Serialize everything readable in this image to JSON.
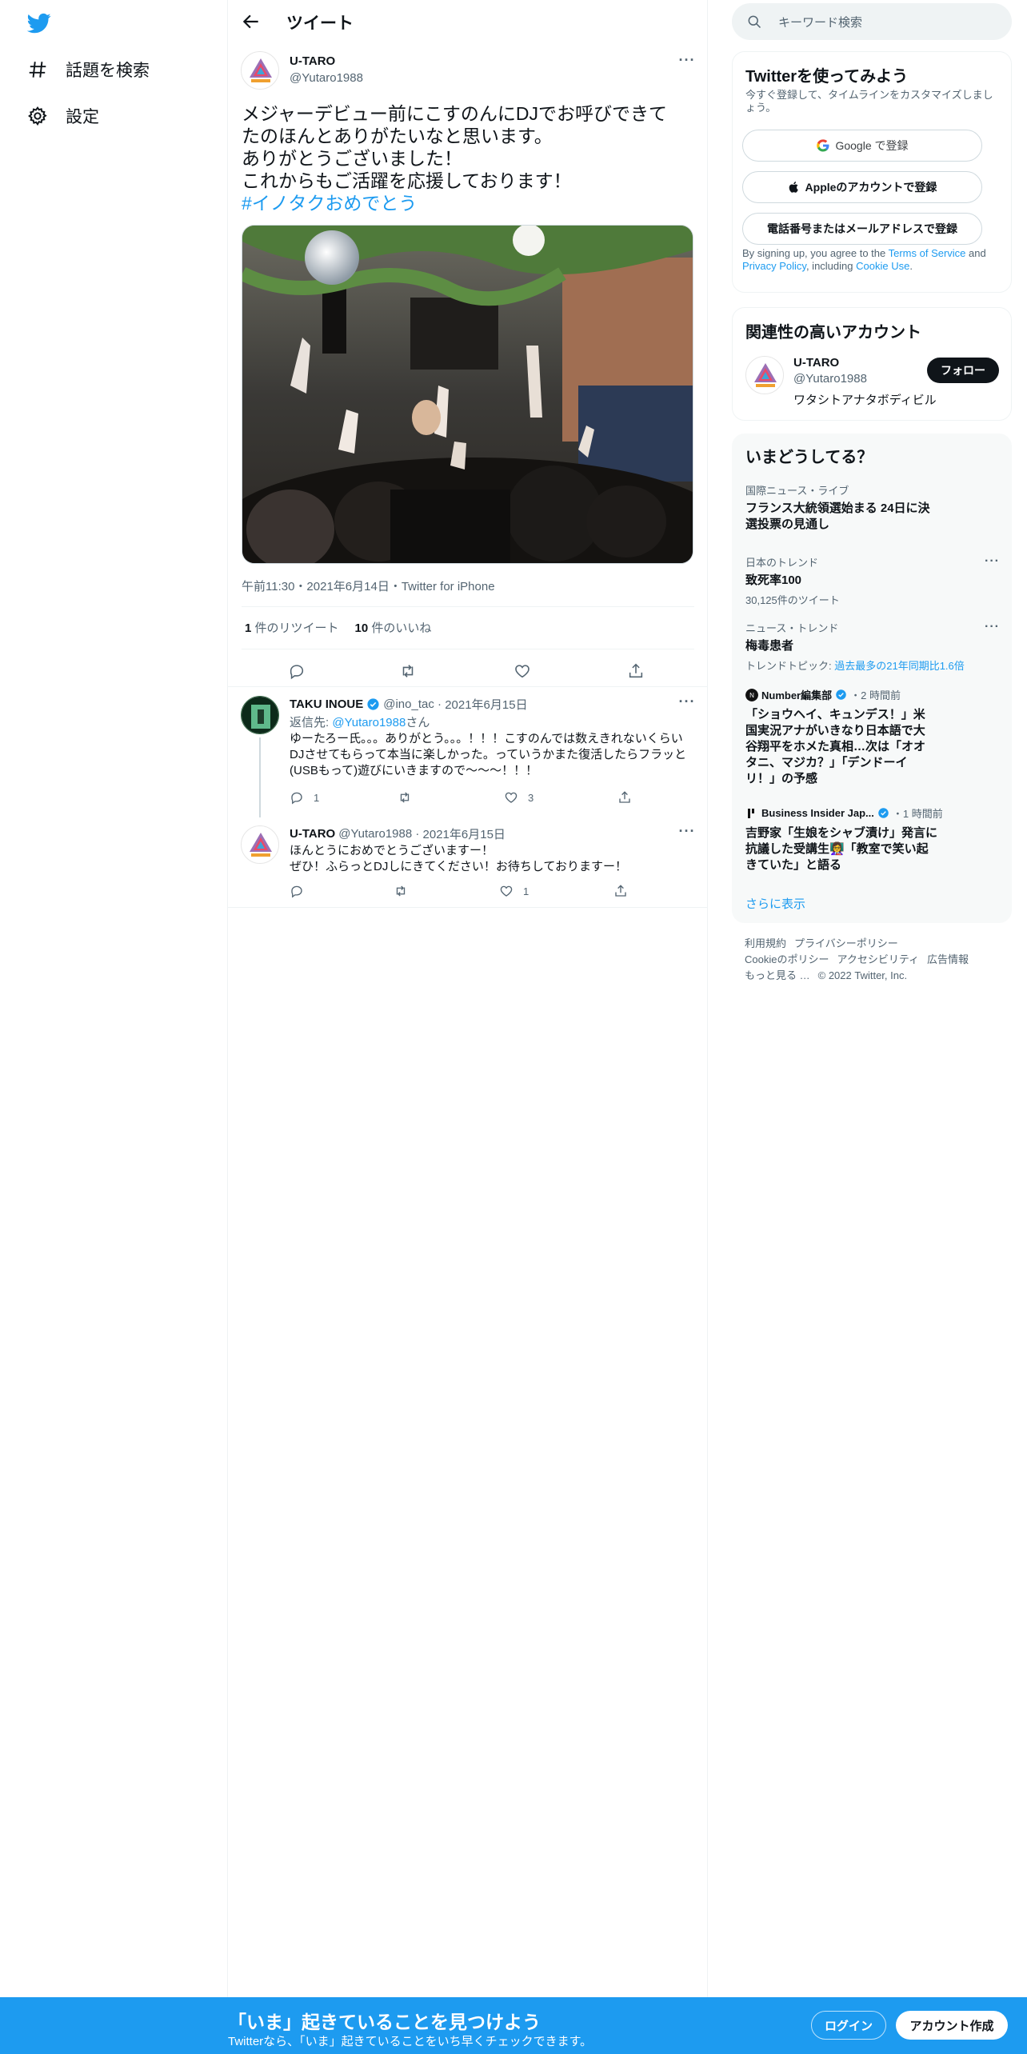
{
  "nav": {
    "logo": "twitter-bird-icon",
    "items": [
      {
        "label": "話題を検索",
        "icon": "hashtag-icon"
      },
      {
        "label": "設定",
        "icon": "gear-icon"
      }
    ]
  },
  "header": {
    "title": "ツイート"
  },
  "tweet": {
    "name": "U-TARO",
    "handle": "@Yutaro1988",
    "text": "メジャーデビュー前にこすのんにDJでお呼びできて\nたのほんとありがたいなと思います。\nありがとうございました！\nこれからもご活躍を応援しております！",
    "hashtag": "#イノタクおめでとう",
    "meta": "午前11:30・2021年6月14日・Twitter for iPhone",
    "retweets_count": "1",
    "retweets_label": "件のリツイート",
    "likes_count": "10",
    "likes_label": "件のいいね"
  },
  "replies": [
    {
      "name": "TAKU INOUE",
      "handle": "@ino_tac",
      "time": "2021年6月15日",
      "reply_to_prefix": "返信先: ",
      "reply_to_handle": "@Yutaro1988",
      "reply_to_suffix": "さん",
      "text": "ゆーたろー氏。。。ありがとう。。。！！！こすのんでは数えきれないくらいDJさせてもらって本当に楽しかった。っていうかまた復活したらフラッと(USBもって)遊びにいきますので〜〜〜！！！",
      "reply_count": "1",
      "retweet_count": "",
      "like_count": "3"
    },
    {
      "name": "U-TARO",
      "handle": "@Yutaro1988",
      "time": "2021年6月15日",
      "text": "ほんとうにおめでとうございますー！\nぜひ！ふらっとDJしにきてください！お待ちしておりますー！",
      "reply_count": "",
      "retweet_count": "",
      "like_count": "1"
    }
  ],
  "search": {
    "placeholder": "キーワード検索"
  },
  "signup": {
    "title": "Twitterを使ってみよう",
    "subtitle": "今すぐ登録して、タイムラインをカスタマイズしましょう。",
    "google": "Google で登録",
    "apple": "Appleのアカウントで登録",
    "phone": "電話番号またはメールアドレスで登録",
    "legal_prefix": "By signing up, you agree to the ",
    "terms": "Terms of Service",
    "legal_and": " and ",
    "privacy": "Privacy Policy",
    "legal_including": ", including ",
    "cookie": "Cookie Use",
    "legal_end": "."
  },
  "related": {
    "title": "関連性の高いアカウント",
    "name": "U-TARO",
    "handle": "@Yutaro1988",
    "bio": "ワタシトアナタボディビル",
    "follow": "フォロー"
  },
  "trends": {
    "title": "いまどうしてる？",
    "items": [
      {
        "context": "国際ニュース・ライブ",
        "name": "フランス大統領選始まる 24日に決選投票の見通し"
      },
      {
        "context": "日本のトレンド",
        "name": "致死率100",
        "count": "30,125件のツイート"
      },
      {
        "context": "ニュース・トレンド",
        "name": "梅毒患者",
        "topic_prefix": "トレンドトピック: ",
        "topic": "過去最多の21年同期比1.6倍"
      },
      {
        "source": "Number編集部",
        "time": "・2 時間前",
        "name": "「ショウヘイ、キュンデス！」米国実況アナがいきなり日本語で大谷翔平をホメた真相…次は「オオタニ、マジカ？」「デンドーイリ！」の予感"
      },
      {
        "source": "Business Insider Jap...",
        "time": "・1 時間前",
        "name": "吉野家「生娘をシャブ漬け」発言に抗議した受講生👩‍🏫「教室で笑い起きていた」と語る"
      }
    ],
    "show_more": "さらに表示"
  },
  "footer": {
    "links": [
      "利用規約",
      "プライバシーポリシー",
      "Cookieのポリシー",
      "アクセシビリティ",
      "広告情報",
      "もっと見る …",
      "© 2022 Twitter, Inc."
    ]
  },
  "bottom": {
    "title": "「いま」起きていることを見つけよう",
    "subtitle": "Twitterなら、「いま」起きていることをいち早くチェックできます。",
    "login": "ログイン",
    "signup": "アカウント作成"
  },
  "colors": {
    "accent": "#1d9bf0",
    "text": "#0f1419",
    "muted": "#536471"
  }
}
